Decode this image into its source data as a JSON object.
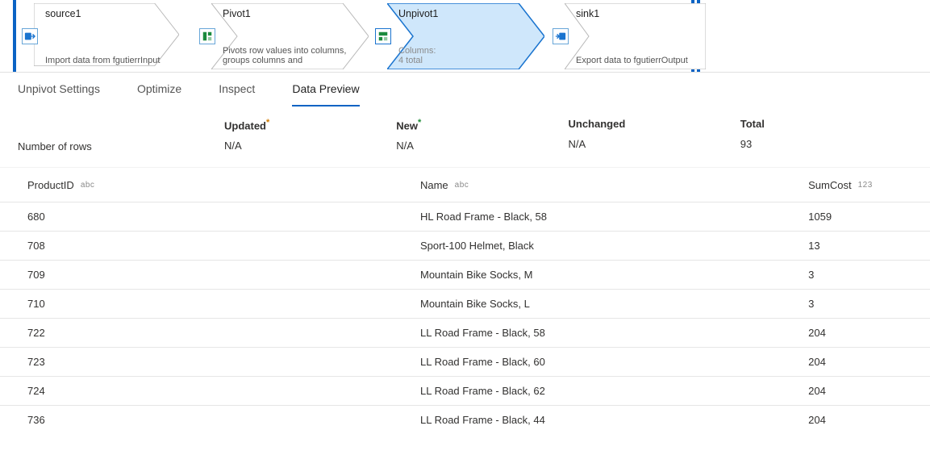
{
  "flow": {
    "nodes": [
      {
        "id": "source1",
        "title": "source1",
        "desc": "Import data from fgutierrInput",
        "selected": false,
        "icon": "source-icon"
      },
      {
        "id": "pivot1",
        "title": "Pivot1",
        "desc": "Pivots row values into columns, groups columns and",
        "selected": false,
        "icon": "pivot-icon"
      },
      {
        "id": "unpivot1",
        "title": "Unpivot1",
        "desc_label": "Columns:",
        "desc": "4 total",
        "selected": true,
        "icon": "unpivot-icon"
      },
      {
        "id": "sink1",
        "title": "sink1",
        "desc": "Export data to fgutierrOutput",
        "selected": false,
        "icon": "sink-icon"
      }
    ]
  },
  "tabs": [
    {
      "id": "settings",
      "label": "Unpivot Settings",
      "active": false
    },
    {
      "id": "optimize",
      "label": "Optimize",
      "active": false
    },
    {
      "id": "inspect",
      "label": "Inspect",
      "active": false
    },
    {
      "id": "preview",
      "label": "Data Preview",
      "active": true
    }
  ],
  "stats": {
    "row_label": "Number of rows",
    "cols": {
      "updated": {
        "label": "Updated",
        "value": "N/A"
      },
      "new": {
        "label": "New",
        "value": "N/A"
      },
      "unchanged": {
        "label": "Unchanged",
        "value": "N/A"
      },
      "total": {
        "label": "Total",
        "value": "93"
      }
    }
  },
  "table": {
    "columns": [
      {
        "name": "ProductID",
        "type": "abc"
      },
      {
        "name": "Name",
        "type": "abc"
      },
      {
        "name": "SumCost",
        "type": "123"
      }
    ],
    "rows": [
      {
        "ProductID": "680",
        "Name": "HL Road Frame - Black, 58",
        "SumCost": "1059"
      },
      {
        "ProductID": "708",
        "Name": "Sport-100 Helmet, Black",
        "SumCost": "13"
      },
      {
        "ProductID": "709",
        "Name": "Mountain Bike Socks, M",
        "SumCost": "3"
      },
      {
        "ProductID": "710",
        "Name": "Mountain Bike Socks, L",
        "SumCost": "3"
      },
      {
        "ProductID": "722",
        "Name": "LL Road Frame - Black, 58",
        "SumCost": "204"
      },
      {
        "ProductID": "723",
        "Name": "LL Road Frame - Black, 60",
        "SumCost": "204"
      },
      {
        "ProductID": "724",
        "Name": "LL Road Frame - Black, 62",
        "SumCost": "204"
      },
      {
        "ProductID": "736",
        "Name": "LL Road Frame - Black, 44",
        "SumCost": "204"
      }
    ]
  }
}
